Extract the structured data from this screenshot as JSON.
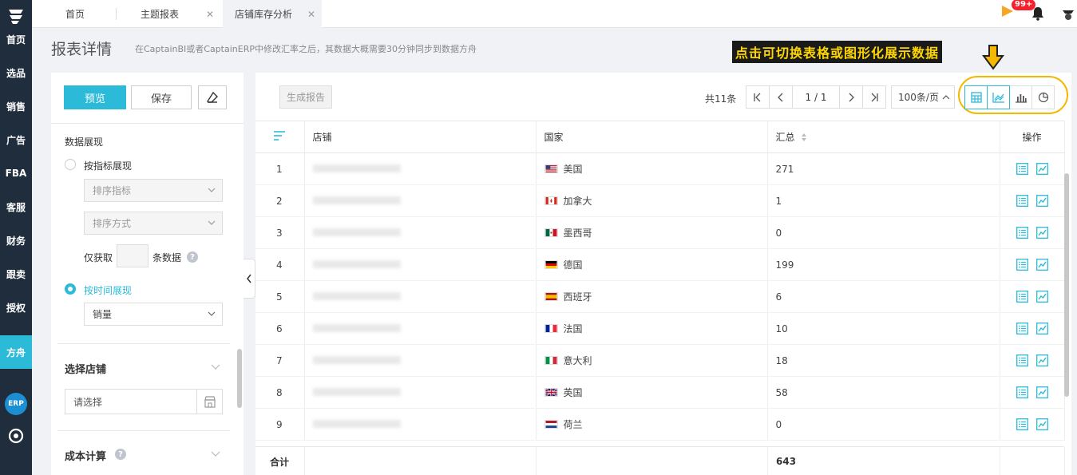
{
  "nav": {
    "items": [
      "首页",
      "选品",
      "销售",
      "广告",
      "FBA",
      "客服",
      "财务",
      "跟卖",
      "授权",
      "方舟"
    ],
    "active": "方舟",
    "erp_label": "ERP"
  },
  "tabs": [
    {
      "label": "首页"
    },
    {
      "label": "主题报表"
    },
    {
      "label": "店铺库存分析"
    }
  ],
  "header": {
    "notification_badge": "99+",
    "title": "报表详情",
    "subtitle": "在CaptainBI或者CaptainERP中修改汇率之后，其数据大概需要30分钟同步到数据方舟",
    "callout": "点击可切换表格或图形化展示数据"
  },
  "panel": {
    "preview_label": "预览",
    "save_label": "保存",
    "data_display_label": "数据展现",
    "by_metric_label": "按指标展现",
    "sort_metric_placeholder": "排序指标",
    "sort_method_placeholder": "排序方式",
    "only_fetch_label": "仅获取",
    "records_label": "条数据",
    "by_time_label": "按时间展现",
    "time_metric_value": "销量",
    "select_store_title": "选择店铺",
    "store_placeholder": "请选择",
    "cost_calc_title": "成本计算",
    "help_glyph": "?"
  },
  "toolbar": {
    "generate_report_label": "生成报告",
    "total_text": "共11条",
    "page_text": "1 / 1",
    "page_size_text": "100条/页"
  },
  "table": {
    "headers": {
      "store": "店铺",
      "country": "国家",
      "sum": "汇总",
      "actions": "操作"
    },
    "rows": [
      {
        "idx": "1",
        "country": "美国",
        "flag": "us",
        "sum": "271"
      },
      {
        "idx": "2",
        "country": "加拿大",
        "flag": "ca",
        "sum": "1"
      },
      {
        "idx": "3",
        "country": "墨西哥",
        "flag": "mx",
        "sum": "0"
      },
      {
        "idx": "4",
        "country": "德国",
        "flag": "de",
        "sum": "199"
      },
      {
        "idx": "5",
        "country": "西班牙",
        "flag": "es",
        "sum": "6"
      },
      {
        "idx": "6",
        "country": "法国",
        "flag": "fr",
        "sum": "10"
      },
      {
        "idx": "7",
        "country": "意大利",
        "flag": "it",
        "sum": "18"
      },
      {
        "idx": "8",
        "country": "英国",
        "flag": "gb",
        "sum": "58"
      },
      {
        "idx": "9",
        "country": "荷兰",
        "flag": "nl",
        "sum": "0"
      }
    ],
    "footer_label": "合计",
    "footer_sum": "643"
  },
  "colors": {
    "accent": "#2bbbd8",
    "nav_bg": "#1f2d3d",
    "highlight": "#f5b800",
    "badge": "#f5222d"
  }
}
